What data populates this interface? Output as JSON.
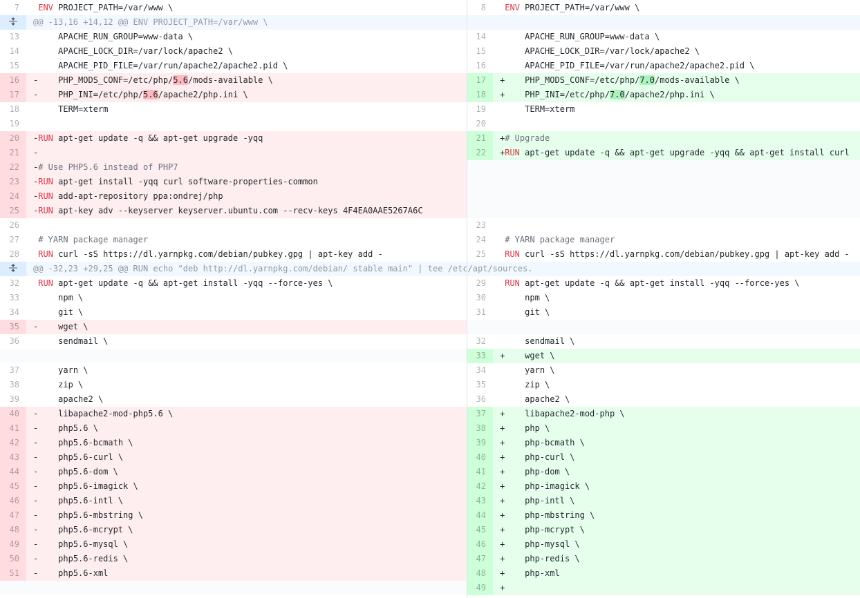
{
  "icons": {
    "expand": "unfold-expand-icon"
  },
  "colors": {
    "deletion_bg": "#ffeef0",
    "deletion_num_bg": "#ffdce0",
    "deletion_highlight": "#fdb8c0",
    "addition_bg": "#e6ffed",
    "addition_num_bg": "#cdffd8",
    "addition_highlight": "#acf2bd",
    "hunk_bg": "#f1f8ff",
    "keyword": "#d73a49",
    "comment": "#6a737d"
  },
  "rows": [
    {
      "l": {
        "t": "ctx",
        "n": "7",
        "c": " ENV PROJECT_PATH=/var/www \\"
      },
      "r": {
        "t": "ctx",
        "n": "8",
        "c": " ENV PROJECT_PATH=/var/www \\"
      }
    },
    {
      "hunk": "@@ -13,16 +14,12 @@ ENV PROJECT_PATH=/var/www \\"
    },
    {
      "l": {
        "t": "ctx",
        "n": "13",
        "c": "     APACHE_RUN_GROUP=www-data \\"
      },
      "r": {
        "t": "ctx",
        "n": "14",
        "c": "     APACHE_RUN_GROUP=www-data \\"
      }
    },
    {
      "l": {
        "t": "ctx",
        "n": "14",
        "c": "     APACHE_LOCK_DIR=/var/lock/apache2 \\"
      },
      "r": {
        "t": "ctx",
        "n": "15",
        "c": "     APACHE_LOCK_DIR=/var/lock/apache2 \\"
      }
    },
    {
      "l": {
        "t": "ctx",
        "n": "15",
        "c": "     APACHE_PID_FILE=/var/run/apache2/apache2.pid \\"
      },
      "r": {
        "t": "ctx",
        "n": "16",
        "c": "     APACHE_PID_FILE=/var/run/apache2/apache2.pid \\"
      }
    },
    {
      "l": {
        "t": "del",
        "n": "16",
        "c": "-    PHP_MODS_CONF=/etc/php/5.6/mods-available \\",
        "h": "5.6"
      },
      "r": {
        "t": "add",
        "n": "17",
        "c": "+    PHP_MODS_CONF=/etc/php/7.0/mods-available \\",
        "h": "7.0"
      }
    },
    {
      "l": {
        "t": "del",
        "n": "17",
        "c": "-    PHP_INI=/etc/php/5.6/apache2/php.ini \\",
        "h": "5.6"
      },
      "r": {
        "t": "add",
        "n": "18",
        "c": "+    PHP_INI=/etc/php/7.0/apache2/php.ini \\",
        "h": "7.0"
      }
    },
    {
      "l": {
        "t": "ctx",
        "n": "18",
        "c": "     TERM=xterm"
      },
      "r": {
        "t": "ctx",
        "n": "19",
        "c": "     TERM=xterm"
      }
    },
    {
      "l": {
        "t": "ctx",
        "n": "19",
        "c": ""
      },
      "r": {
        "t": "ctx",
        "n": "20",
        "c": ""
      }
    },
    {
      "l": {
        "t": "del",
        "n": "20",
        "c": "-RUN apt-get update -q && apt-get upgrade -yqq"
      },
      "r": {
        "t": "add",
        "n": "21",
        "c": "+# Upgrade"
      }
    },
    {
      "l": {
        "t": "del",
        "n": "21",
        "c": "-"
      },
      "r": {
        "t": "add",
        "n": "22",
        "c": "+RUN apt-get update -q && apt-get upgrade -yqq && apt-get install curl"
      }
    },
    {
      "l": {
        "t": "del",
        "n": "22",
        "c": "-# Use PHP5.6 instead of PHP7"
      },
      "r": {
        "t": "bempty"
      }
    },
    {
      "l": {
        "t": "del",
        "n": "23",
        "c": "-RUN apt-get install -yqq curl software-properties-common"
      },
      "r": {
        "t": "bempty"
      }
    },
    {
      "l": {
        "t": "del",
        "n": "24",
        "c": "-RUN add-apt-repository ppa:ondrej/php"
      },
      "r": {
        "t": "bempty"
      }
    },
    {
      "l": {
        "t": "del",
        "n": "25",
        "c": "-RUN apt-key adv --keyserver keyserver.ubuntu.com --recv-keys 4F4EA0AAE5267A6C"
      },
      "r": {
        "t": "bempty"
      }
    },
    {
      "l": {
        "t": "ctx",
        "n": "26",
        "c": ""
      },
      "r": {
        "t": "ctx",
        "n": "23",
        "c": ""
      }
    },
    {
      "l": {
        "t": "ctx",
        "n": "27",
        "c": " # YARN package manager"
      },
      "r": {
        "t": "ctx",
        "n": "24",
        "c": " # YARN package manager"
      }
    },
    {
      "l": {
        "t": "ctx",
        "n": "28",
        "c": " RUN curl -sS https://dl.yarnpkg.com/debian/pubkey.gpg | apt-key add -"
      },
      "r": {
        "t": "ctx",
        "n": "25",
        "c": " RUN curl -sS https://dl.yarnpkg.com/debian/pubkey.gpg | apt-key add -"
      }
    },
    {
      "hunk": "@@ -32,23 +29,25 @@ RUN echo \"deb http://dl.yarnpkg.com/debian/ stable main\" | tee /etc/apt/sources."
    },
    {
      "l": {
        "t": "ctx",
        "n": "32",
        "c": " RUN apt-get update -q && apt-get install -yqq --force-yes \\"
      },
      "r": {
        "t": "ctx",
        "n": "29",
        "c": " RUN apt-get update -q && apt-get install -yqq --force-yes \\"
      }
    },
    {
      "l": {
        "t": "ctx",
        "n": "33",
        "c": "     npm \\"
      },
      "r": {
        "t": "ctx",
        "n": "30",
        "c": "     npm \\"
      }
    },
    {
      "l": {
        "t": "ctx",
        "n": "34",
        "c": "     git \\"
      },
      "r": {
        "t": "ctx",
        "n": "31",
        "c": "     git \\"
      }
    },
    {
      "l": {
        "t": "del",
        "n": "35",
        "c": "-    wget \\"
      },
      "r": {
        "t": "empty"
      }
    },
    {
      "l": {
        "t": "ctx",
        "n": "36",
        "c": "     sendmail \\"
      },
      "r": {
        "t": "ctx",
        "n": "32",
        "c": "     sendmail \\"
      }
    },
    {
      "l": {
        "t": "empty"
      },
      "r": {
        "t": "add",
        "n": "33",
        "c": "+    wget \\"
      }
    },
    {
      "l": {
        "t": "ctx",
        "n": "37",
        "c": "     yarn \\"
      },
      "r": {
        "t": "ctx",
        "n": "34",
        "c": "     yarn \\"
      }
    },
    {
      "l": {
        "t": "ctx",
        "n": "38",
        "c": "     zip \\"
      },
      "r": {
        "t": "ctx",
        "n": "35",
        "c": "     zip \\"
      }
    },
    {
      "l": {
        "t": "ctx",
        "n": "39",
        "c": "     apache2 \\"
      },
      "r": {
        "t": "ctx",
        "n": "36",
        "c": "     apache2 \\"
      }
    },
    {
      "l": {
        "t": "del",
        "n": "40",
        "c": "-    libapache2-mod-php5.6 \\"
      },
      "r": {
        "t": "add",
        "n": "37",
        "c": "+    libapache2-mod-php \\"
      }
    },
    {
      "l": {
        "t": "del",
        "n": "41",
        "c": "-    php5.6 \\"
      },
      "r": {
        "t": "add",
        "n": "38",
        "c": "+    php \\"
      }
    },
    {
      "l": {
        "t": "del",
        "n": "42",
        "c": "-    php5.6-bcmath \\"
      },
      "r": {
        "t": "add",
        "n": "39",
        "c": "+    php-bcmath \\"
      }
    },
    {
      "l": {
        "t": "del",
        "n": "43",
        "c": "-    php5.6-curl \\"
      },
      "r": {
        "t": "add",
        "n": "40",
        "c": "+    php-curl \\"
      }
    },
    {
      "l": {
        "t": "del",
        "n": "44",
        "c": "-    php5.6-dom \\"
      },
      "r": {
        "t": "add",
        "n": "41",
        "c": "+    php-dom \\"
      }
    },
    {
      "l": {
        "t": "del",
        "n": "45",
        "c": "-    php5.6-imagick \\"
      },
      "r": {
        "t": "add",
        "n": "42",
        "c": "+    php-imagick \\"
      }
    },
    {
      "l": {
        "t": "del",
        "n": "46",
        "c": "-    php5.6-intl \\"
      },
      "r": {
        "t": "add",
        "n": "43",
        "c": "+    php-intl \\"
      }
    },
    {
      "l": {
        "t": "del",
        "n": "47",
        "c": "-    php5.6-mbstring \\"
      },
      "r": {
        "t": "add",
        "n": "44",
        "c": "+    php-mbstring \\"
      }
    },
    {
      "l": {
        "t": "del",
        "n": "48",
        "c": "-    php5.6-mcrypt \\"
      },
      "r": {
        "t": "add",
        "n": "45",
        "c": "+    php-mcrypt \\"
      }
    },
    {
      "l": {
        "t": "del",
        "n": "49",
        "c": "-    php5.6-mysql \\"
      },
      "r": {
        "t": "add",
        "n": "46",
        "c": "+    php-mysql \\"
      }
    },
    {
      "l": {
        "t": "del",
        "n": "50",
        "c": "-    php5.6-redis \\"
      },
      "r": {
        "t": "add",
        "n": "47",
        "c": "+    php-redis \\"
      }
    },
    {
      "l": {
        "t": "del",
        "n": "51",
        "c": "-    php5.6-xml"
      },
      "r": {
        "t": "add",
        "n": "48",
        "c": "+    php-xml"
      }
    },
    {
      "l": {
        "t": "empty"
      },
      "r": {
        "t": "add",
        "n": "49",
        "c": "+"
      }
    }
  ]
}
